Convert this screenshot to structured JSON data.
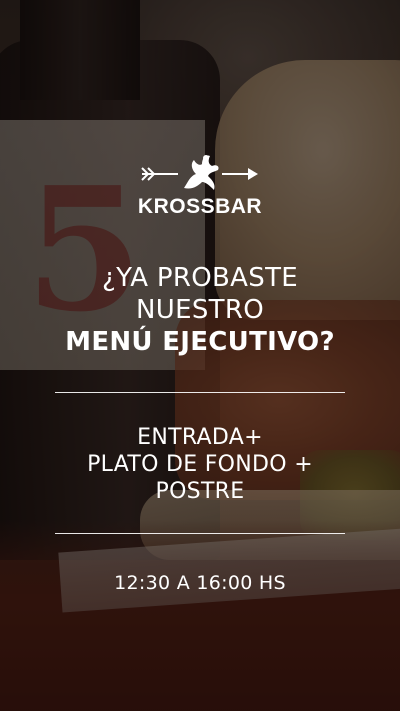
{
  "brand": {
    "name": "KROSSBAR",
    "logo_icon": "krossbar-logo-icon"
  },
  "headline": {
    "line1": "¿YA PROBASTE",
    "line2": "NUESTRO",
    "line3": "MENÚ EJECUTIVO?"
  },
  "menu": {
    "line1": "ENTRADA+",
    "line2": "PLATO DE FONDO +",
    "line3": "POSTRE"
  },
  "hours": {
    "text": "12:30 A 16:00 HS"
  },
  "colors": {
    "text": "#ffffff",
    "overlay": "#120a08"
  }
}
